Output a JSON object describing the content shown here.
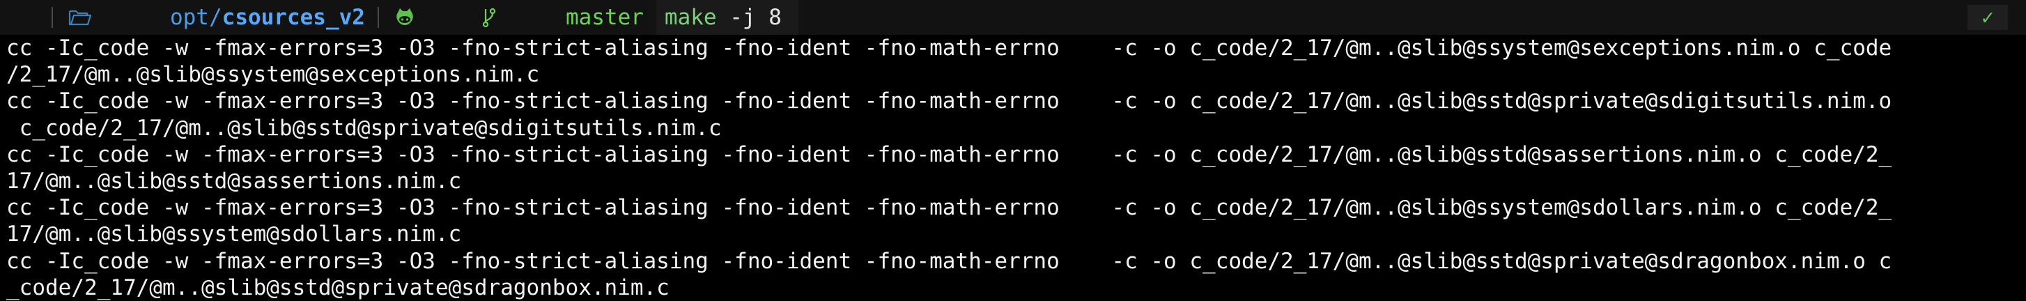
{
  "prompt": {
    "os_icon": "linux-tux-icon",
    "folder_icon": "folder-open-icon",
    "path_prefix": "opt",
    "path_separator": "/",
    "path_current": "csources_v2",
    "git_icon": "github-icon",
    "branch_icon": "git-branch-icon",
    "branch": "master",
    "command": "make",
    "command_args": " -j 8",
    "status_icon": "checkmark-icon",
    "status_symbol": "✓"
  },
  "output": {
    "lines": [
      "cc -Ic_code -w -fmax-errors=3 -O3 -fno-strict-aliasing -fno-ident -fno-math-errno    -c -o c_code/2_17/@m..@slib@ssystem@sexceptions.nim.o c_code",
      "/2_17/@m..@slib@ssystem@sexceptions.nim.c",
      "cc -Ic_code -w -fmax-errors=3 -O3 -fno-strict-aliasing -fno-ident -fno-math-errno    -c -o c_code/2_17/@m..@slib@sstd@sprivate@sdigitsutils.nim.o",
      " c_code/2_17/@m..@slib@sstd@sprivate@sdigitsutils.nim.c",
      "cc -Ic_code -w -fmax-errors=3 -O3 -fno-strict-aliasing -fno-ident -fno-math-errno    -c -o c_code/2_17/@m..@slib@sstd@sassertions.nim.o c_code/2_",
      "17/@m..@slib@sstd@sassertions.nim.c",
      "cc -Ic_code -w -fmax-errors=3 -O3 -fno-strict-aliasing -fno-ident -fno-math-errno    -c -o c_code/2_17/@m..@slib@ssystem@sdollars.nim.o c_code/2_",
      "17/@m..@slib@ssystem@sdollars.nim.c",
      "cc -Ic_code -w -fmax-errors=3 -O3 -fno-strict-aliasing -fno-ident -fno-math-errno    -c -o c_code/2_17/@m..@slib@sstd@sprivate@sdragonbox.nim.o c",
      "_code/2_17/@m..@slib@sstd@sprivate@sdragonbox.nim.c"
    ]
  }
}
